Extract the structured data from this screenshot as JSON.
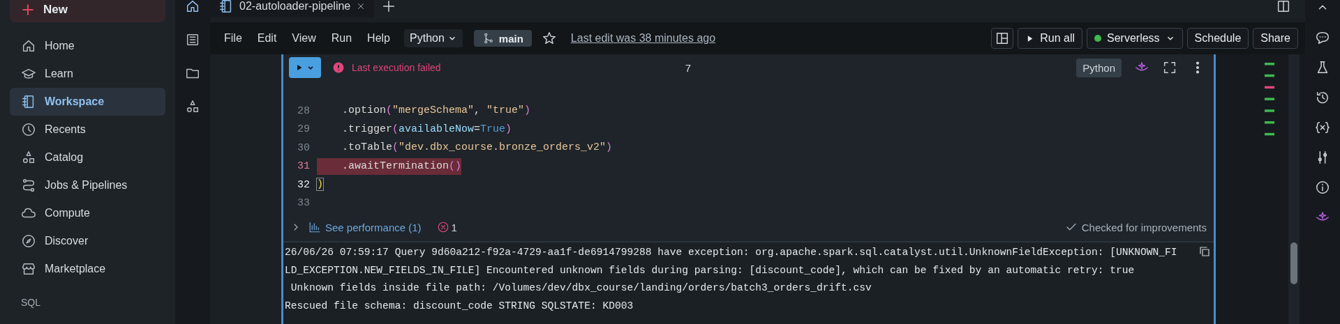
{
  "sidebar": {
    "new_button": "New",
    "items": [
      {
        "label": "Home",
        "selected": false
      },
      {
        "label": "Learn",
        "selected": false
      },
      {
        "label": "Workspace",
        "selected": true
      },
      {
        "label": "Recents",
        "selected": false
      },
      {
        "label": "Catalog",
        "selected": false
      },
      {
        "label": "Jobs & Pipelines",
        "selected": false
      },
      {
        "label": "Compute",
        "selected": false
      },
      {
        "label": "Discover",
        "selected": false
      },
      {
        "label": "Marketplace",
        "selected": false
      }
    ],
    "section": "SQL"
  },
  "tab": {
    "title": "02-autoloader-pipeline"
  },
  "menu": [
    "File",
    "Edit",
    "View",
    "Run",
    "Help"
  ],
  "language": "Python",
  "branch": "main",
  "last_edit": "Last edit was 38 minutes ago",
  "run_all": "Run all",
  "compute": {
    "label": "Serverless",
    "connected": true
  },
  "schedule": "Schedule",
  "share": "Share",
  "cell": {
    "status": {
      "text": "Last execution failed",
      "failed": true
    },
    "count": "7",
    "language": "Python",
    "lines": [
      {
        "number": "28",
        "error": false,
        "current": false,
        "tokens": [
          {
            "kind": "plain",
            "text": "    .option"
          },
          {
            "kind": "paren",
            "text": "("
          },
          {
            "kind": "string",
            "text": "\"mergeSchema\""
          },
          {
            "kind": "plain",
            "text": ", "
          },
          {
            "kind": "string",
            "text": "\"true\""
          },
          {
            "kind": "paren",
            "text": ")"
          }
        ]
      },
      {
        "number": "29",
        "error": false,
        "current": false,
        "tokens": [
          {
            "kind": "plain",
            "text": "    .trigger"
          },
          {
            "kind": "paren",
            "text": "("
          },
          {
            "kind": "param",
            "text": "availableNow"
          },
          {
            "kind": "plain",
            "text": "="
          },
          {
            "kind": "const",
            "text": "True"
          },
          {
            "kind": "paren",
            "text": ")"
          }
        ]
      },
      {
        "number": "30",
        "error": false,
        "current": false,
        "tokens": [
          {
            "kind": "plain",
            "text": "    .toTable"
          },
          {
            "kind": "paren",
            "text": "("
          },
          {
            "kind": "string",
            "text": "\"dev.dbx_course.bronze_orders_v2\""
          },
          {
            "kind": "paren",
            "text": ")"
          }
        ]
      },
      {
        "number": "31",
        "error": true,
        "current": false,
        "tokens": [
          {
            "kind": "plain",
            "text": "    .awaitTermination"
          },
          {
            "kind": "paren",
            "text": "()"
          }
        ]
      },
      {
        "number": "32",
        "error": false,
        "current": true,
        "tokens": [
          {
            "kind": "bracket",
            "text": ")"
          }
        ]
      },
      {
        "number": "33",
        "error": false,
        "current": false
      }
    ],
    "performance": "See performance (1)",
    "error_count": "1",
    "checked": "Checked for improvements"
  },
  "output": [
    "26/06/26 07:59:17 Query 9d60a212-f92a-4729-aa1f-de6914799288 have exception: org.apache.spark.sql.catalyst.util.UnknownFieldException: [UNKNOWN_FI",
    "LD_EXCEPTION.NEW_FIELDS_IN_FILE] Encountered unknown fields during parsing: [discount_code], which can be fixed by an automatic retry: true",
    " Unknown fields inside file path: /Volumes/dev/dbx_course/landing/orders/batch3_orders_drift.csv",
    "Rescued file schema: discount_code STRING SQLSTATE: KD003"
  ]
}
